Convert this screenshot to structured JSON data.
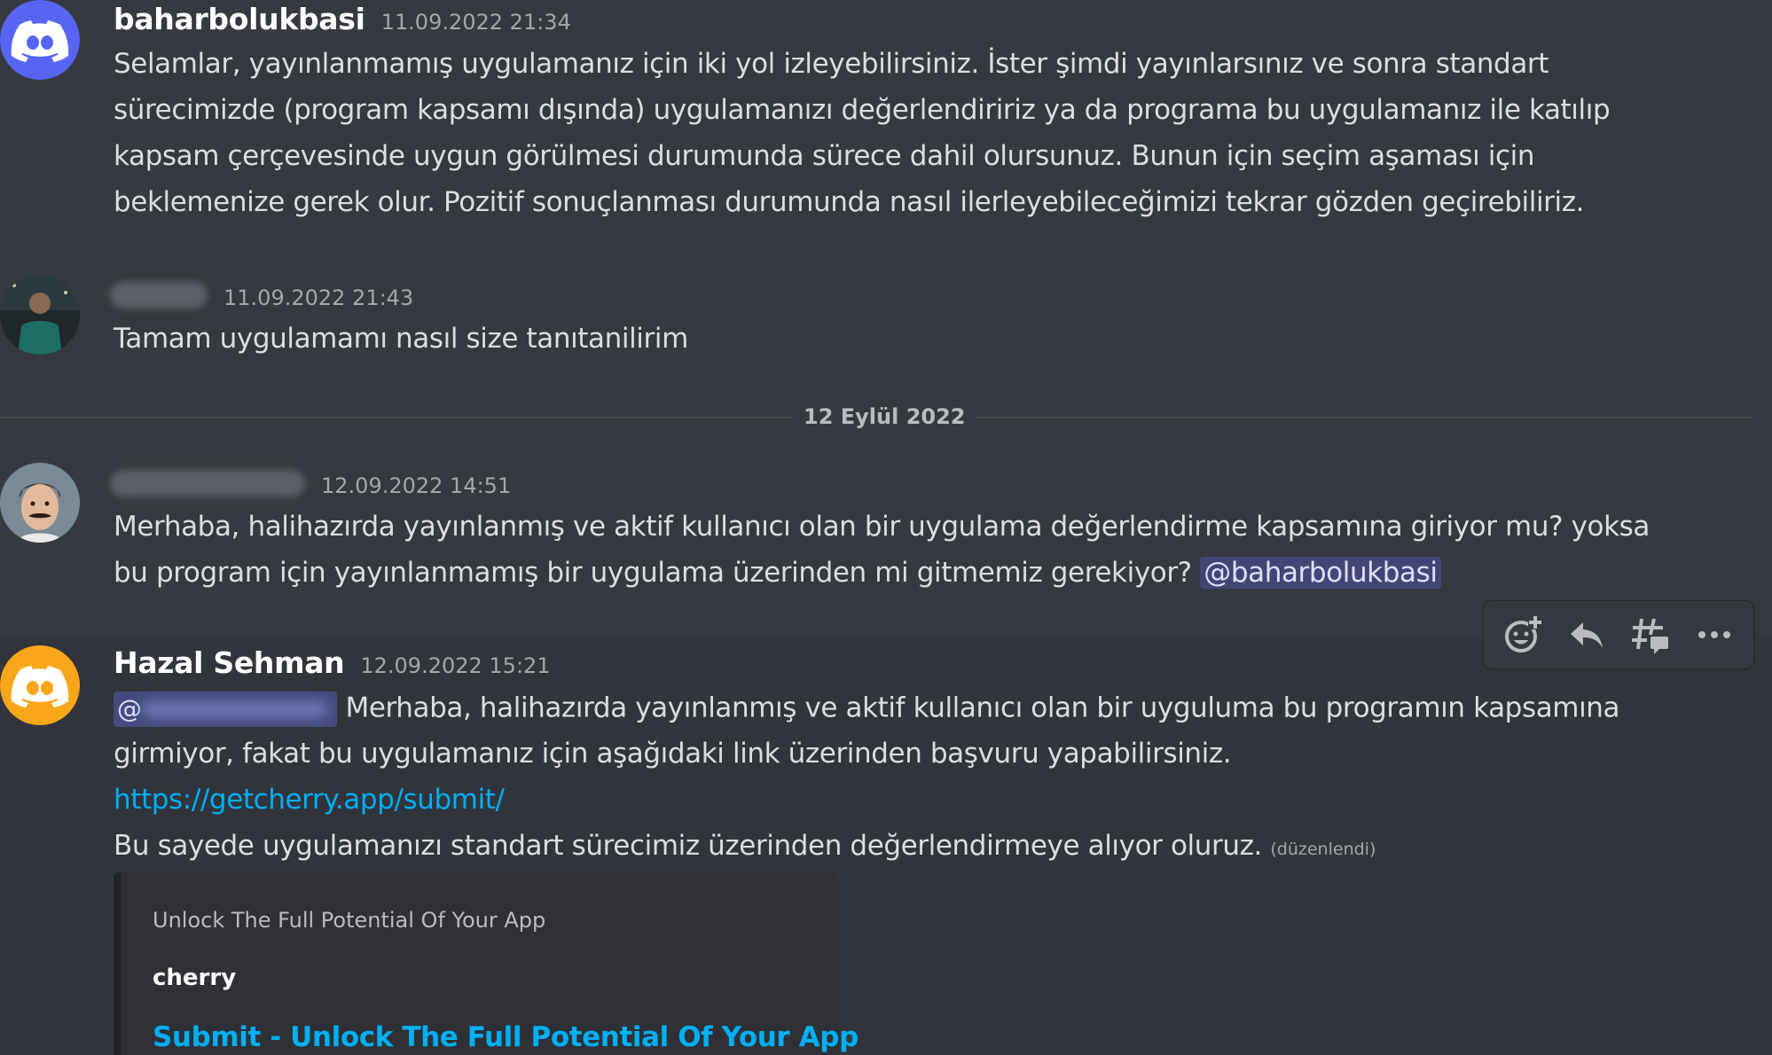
{
  "colors": {
    "background": "#36393f",
    "mention_bg": "#414675",
    "link": "#00aff4",
    "discord_blurple": "#5865f2",
    "discord_orange": "#faa61a"
  },
  "messages": [
    {
      "username": "baharbolukbasi",
      "timestamp": "11.09.2022 21:34",
      "avatar_icon": "discord-logo-blurple",
      "lines": [
        "Selamlar, yayınlanmamış uygulamanız için iki yol izleyebilirsiniz. İster şimdi yayınlarsınız ve sonra standart",
        "sürecimizde (program kapsamı dışında) uygulamanızı değerlendiririz ya da programa bu uygulamanız ile katılıp",
        "kapsam çerçevesinde uygun görülmesi durumunda sürece dahil olursunuz. Bunun için seçim aşaması için",
        "beklemenize gerek olur. Pozitif sonuçlanması durumunda nasıl ilerleyebileceğimizi tekrar gözden geçirebiliriz."
      ]
    },
    {
      "username_redacted": true,
      "timestamp": "11.09.2022 21:43",
      "avatar_icon": "user-photo",
      "lines": [
        "Tamam uygulamamı nasıl size tanıtanilirim"
      ]
    },
    {
      "username_redacted": true,
      "timestamp": "12.09.2022 14:51",
      "avatar_icon": "user-photo",
      "lines": [
        "Merhaba, halihazırda yayınlanmış ve aktif kullanıcı olan bir uygulama değerlendirme kapsamına giriyor mu? yoksa",
        "bu program için yayınlanmamış bir uygulama üzerinden mi gitmemiz gerekiyor?"
      ],
      "mention": "@baharbolukbasi"
    },
    {
      "username": "Hazal Sehman",
      "timestamp": "12.09.2022 15:21",
      "avatar_icon": "discord-logo-orange",
      "mention_prefix": "@",
      "lines": [
        "Merhaba, halihazırda yayınlanmış ve aktif kullanıcı olan bir uyguluma bu programın kapsamına",
        "girmiyor, fakat bu uygulamanız için aşağıdaki link üzerinden başvuru yapabilirsiniz."
      ],
      "link": "https://getcherry.app/submit/",
      "last_line": "Bu sayede uygulamanızı standart sürecimiz üzerinden değerlendirmeye alıyor oluruz.",
      "edited": "(düzenlendi)",
      "embed": {
        "provider": "Unlock The Full Potential Of Your App",
        "author": "cherry",
        "title": "Submit - Unlock The Full Potential Of Your App"
      }
    }
  ],
  "date_divider": "12 Eylül 2022",
  "toolbar": {
    "icons": [
      "add-reaction-icon",
      "reply-icon",
      "create-thread-icon",
      "more-icon"
    ]
  }
}
